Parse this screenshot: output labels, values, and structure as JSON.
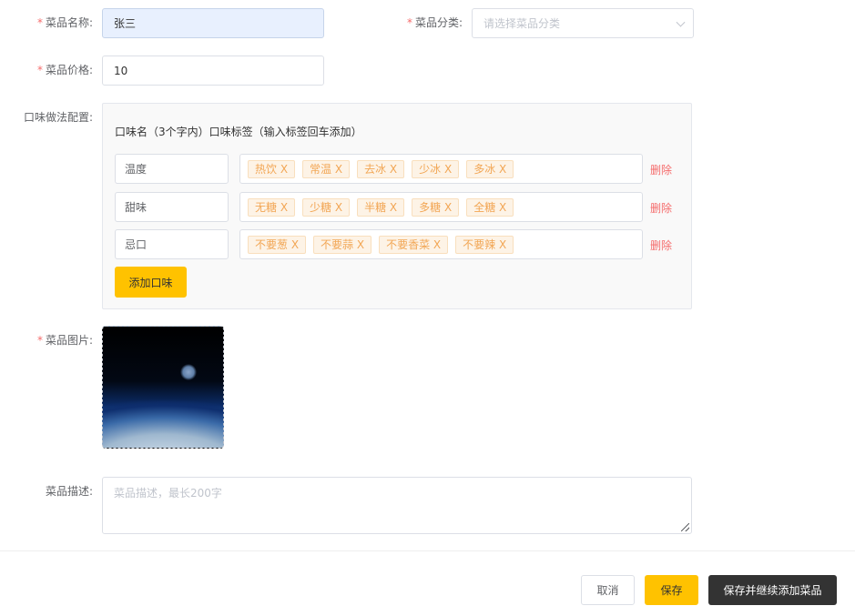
{
  "form": {
    "name": {
      "required_mark": "*",
      "label": "菜品名称:",
      "value": "张三"
    },
    "category": {
      "required_mark": "*",
      "label": "菜品分类:",
      "placeholder": "请选择菜品分类"
    },
    "price": {
      "required_mark": "*",
      "label": "菜品价格:",
      "value": "10"
    },
    "flavor": {
      "label": "口味做法配置:",
      "header": "口味名（3个字内）口味标签（输入标签回车添加）",
      "rows": [
        {
          "name": "温度",
          "tags": [
            "热饮 X",
            "常温 X",
            "去冰 X",
            "少冰 X",
            "多冰 X"
          ],
          "delete_label": "删除"
        },
        {
          "name": "甜味",
          "tags": [
            "无糖 X",
            "少糖 X",
            "半糖 X",
            "多糖 X",
            "全糖 X"
          ],
          "delete_label": "删除"
        },
        {
          "name": "忌口",
          "tags": [
            "不要葱 X",
            "不要蒜 X",
            "不要香菜 X",
            "不要辣 X"
          ],
          "delete_label": "删除"
        }
      ],
      "add_label": "添加口味"
    },
    "image": {
      "required_mark": "*",
      "label": "菜品图片:"
    },
    "description": {
      "label": "菜品描述:",
      "placeholder": "菜品描述，最长200字"
    }
  },
  "footer": {
    "cancel_label": "取消",
    "save_label": "保存",
    "save_continue_label": "保存并继续添加菜品"
  },
  "colors": {
    "accent": "#ffc200",
    "required": "#f56c6c",
    "tag_text": "#f2a654",
    "dark_button": "#333333"
  }
}
